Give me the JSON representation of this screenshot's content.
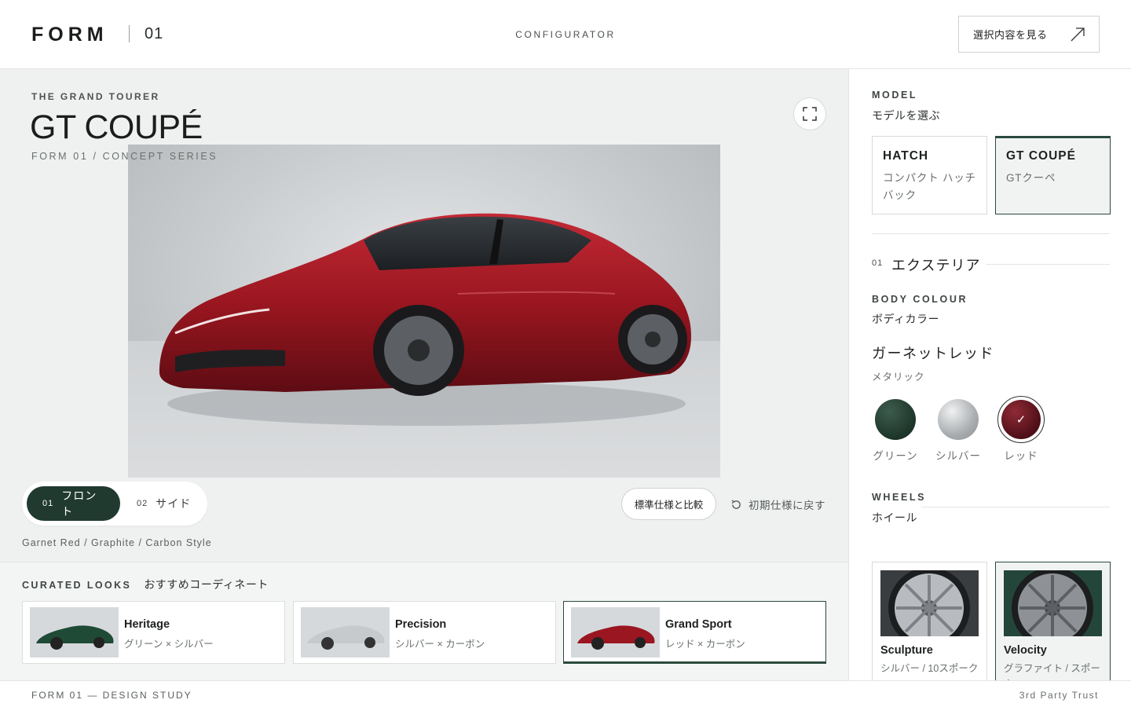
{
  "header": {
    "logo": "FORM",
    "logo_number": "01",
    "nav_center": "CONFIGURATOR",
    "summary_button": "選択内容を見る"
  },
  "stage": {
    "eyebrow": "THE GRAND TOURER",
    "title": "GT COUPÉ",
    "series": "FORM 01 / CONCEPT SERIES",
    "views": [
      {
        "num": "01",
        "label": "フロント",
        "active": true
      },
      {
        "num": "02",
        "label": "サイド",
        "active": false
      }
    ],
    "compare_button": "標準仕様と比較",
    "reset_link": "初期仕様に戻す",
    "spec_line": "Garnet Red / Graphite / Carbon Style"
  },
  "curated": {
    "title_en": "CURATED LOOKS",
    "title_jp": "おすすめコーディネート",
    "looks": [
      {
        "name": "Heritage",
        "sub": "グリーン × シルバー",
        "color": "#1f4a36"
      },
      {
        "name": "Precision",
        "sub": "シルバー × カーボン",
        "color": "#c6cacd"
      },
      {
        "name": "Grand Sport",
        "sub": "レッド × カーボン",
        "color": "#9a1620"
      }
    ]
  },
  "sidebar": {
    "model_en": "MODEL",
    "model_jp": "モデルを選ぶ",
    "models": [
      {
        "title": "HATCH",
        "sub": "コンパクト ハッチバック"
      },
      {
        "title": "GT COUPÉ",
        "sub": "GTクーペ"
      }
    ],
    "exterior_num": "01",
    "exterior_title": "エクステリア",
    "body_en": "BODY COLOUR",
    "body_jp": "ボディカラー",
    "colour_name": "ガーネットレッド",
    "colour_finish": "メタリック",
    "swatches": [
      {
        "label": "グリーン",
        "hex": "#1d3529"
      },
      {
        "label": "シルバー",
        "hex": "#a9adb0"
      },
      {
        "label": "レッド",
        "hex": "#5e1420"
      }
    ],
    "swatch_check": "✓",
    "wheels_en": "WHEELS",
    "wheels_jp": "ホイール",
    "wheels": [
      {
        "title": "Sculpture",
        "sub": "シルバー / 10スポーク"
      },
      {
        "title": "Velocity",
        "sub": "グラファイト / スポーク"
      }
    ]
  },
  "footer": {
    "left": "FORM 01 — DESIGN STUDY",
    "right": "3rd Party Trust"
  },
  "icons": {
    "summary": "arrow-up-right-icon",
    "fullscreen": "expand-icon",
    "reset": "rotate-ccw-icon"
  },
  "colors": {
    "accent": "#213a30",
    "car_red": "#9a1620"
  }
}
